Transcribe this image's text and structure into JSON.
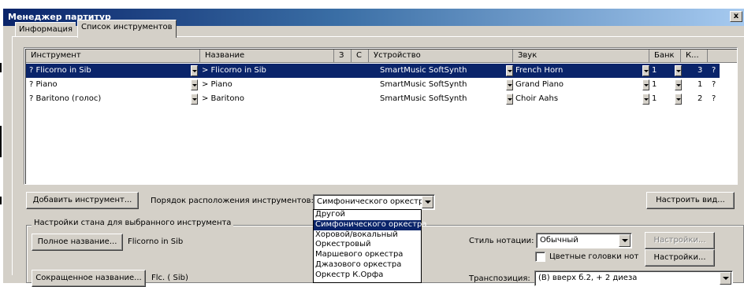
{
  "window": {
    "title": "Менеджер партитур",
    "close_glyph": "x"
  },
  "tabs": [
    {
      "label": "Информация"
    },
    {
      "label": "Список инструментов"
    }
  ],
  "table": {
    "headers": [
      "Инструмент",
      "Название",
      "З",
      "С",
      "Устройство",
      "Звук",
      "Банк",
      "К..."
    ],
    "rows": [
      {
        "instrument": "? Flicorno in Sib",
        "name": "> Flicorno in Sib",
        "device": "SmartMusic SoftSynth",
        "sound": "French Horn",
        "bank": "1",
        "k": "3",
        "q": "?"
      },
      {
        "instrument": "? Piano",
        "name": "> Piano",
        "device": "SmartMusic SoftSynth",
        "sound": "Grand Piano",
        "bank": "1",
        "k": "1",
        "q": "?"
      },
      {
        "instrument": "? Baritono (голос)",
        "name": "> Baritono",
        "device": "SmartMusic SoftSynth",
        "sound": "Choir Aahs",
        "bank": "1",
        "k": "2",
        "q": "?"
      }
    ]
  },
  "controls": {
    "add_instrument": "Добавить инструмент...",
    "order_label": "Порядок расположения инструментов:",
    "order_value": "Симфонического оркестра",
    "configure_view": "Настроить вид...",
    "staff_settings_group": "Настройки стана для выбранного инструмента",
    "full_name_button": "Полное название...",
    "full_name_value": "Flicorno in Sib",
    "short_name_button": "Сокращенное название...",
    "short_name_value": "Flc. ( Sib)",
    "notation_style_label": "Стиль нотации:",
    "notation_style_value": "Обычный",
    "settings_disabled": "Настройки...",
    "color_heads_label": "Цветные головки нот",
    "settings_enabled": "Настройки...",
    "transposition_label": "Транспозиция:",
    "transposition_value": "(B) вверх б.2, + 2 диеза"
  },
  "order_dropdown": {
    "options": [
      "Другой",
      "Симфонического оркестра",
      "Хоровой/вокальный",
      "Оркестровый",
      "Маршевого оркестра",
      "Джазового оркестра",
      "Оркестр К.Орфа"
    ],
    "selected_index": 1
  },
  "colors": {
    "title_gradient_start": "#0a246a",
    "title_gradient_end": "#a6caf0",
    "selection": "#0a246a",
    "face": "#d4d0c8"
  }
}
